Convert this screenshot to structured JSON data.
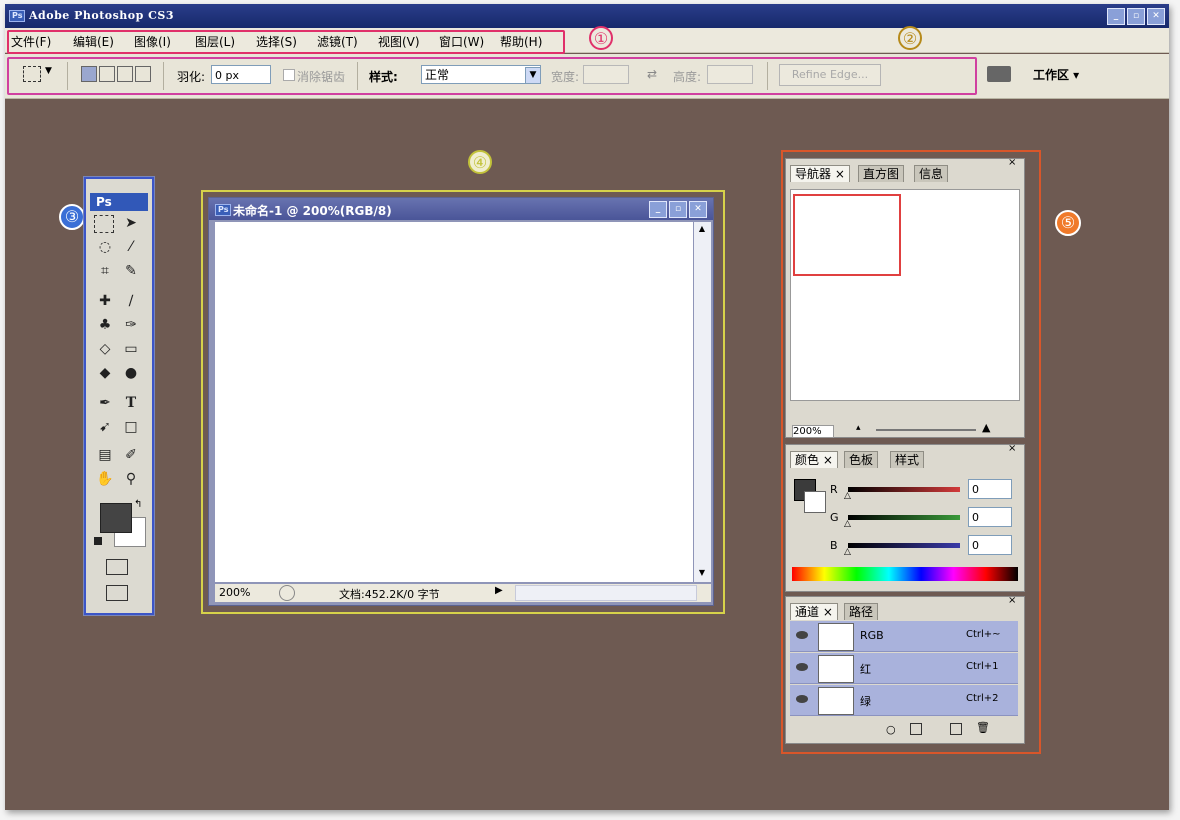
{
  "app": {
    "title": "Adobe Photoshop CS3",
    "icon_text": "Ps",
    "window_buttons": [
      "_",
      "▫",
      "✕"
    ]
  },
  "menubar": {
    "items": [
      "文件(F)",
      "编辑(E)",
      "图像(I)",
      "图层(L)",
      "选择(S)",
      "滤镜(T)",
      "视图(V)",
      "窗口(W)",
      "帮助(H)"
    ]
  },
  "callouts": [
    "①",
    "②",
    "③",
    "④",
    "⑤"
  ],
  "options_bar": {
    "feather_label": "羽化:",
    "feather_value": "0 px",
    "antialias_label": "消除锯齿",
    "style_label": "样式:",
    "style_value": "正常",
    "width_label": "宽度:",
    "height_label": "高度:",
    "refine_edge": "Refine Edge...",
    "workspace": "工作区 ▾"
  },
  "tools_panel": {
    "header": "Ps"
  },
  "document": {
    "title": "未命名-1 @ 200%(RGB/8)",
    "zoom": "200%",
    "doc_info": "文档:452.2K/0 字节"
  },
  "navigator_panel": {
    "tabs": [
      "导航器 ×",
      "直方图",
      "信息"
    ],
    "zoom": "200%"
  },
  "color_panel": {
    "tabs": [
      "颜色 ×",
      "色板",
      "样式"
    ],
    "channels": [
      {
        "label": "R",
        "value": "0",
        "color": "#d33a3a"
      },
      {
        "label": "G",
        "value": "0",
        "color": "#3a9a3a"
      },
      {
        "label": "B",
        "value": "0",
        "color": "#3a3aa8"
      }
    ]
  },
  "channels_panel": {
    "tabs": [
      "通道 ×",
      "路径"
    ],
    "rows": [
      {
        "name": "RGB",
        "shortcut": "Ctrl+~"
      },
      {
        "name": "红",
        "shortcut": "Ctrl+1"
      },
      {
        "name": "绿",
        "shortcut": "Ctrl+2"
      }
    ]
  },
  "colors": {
    "titlebar": "#1f327a",
    "workspace_bg": "#6e5a52",
    "callout_red": "#e0306a",
    "callout_orange": "#d9562a"
  }
}
